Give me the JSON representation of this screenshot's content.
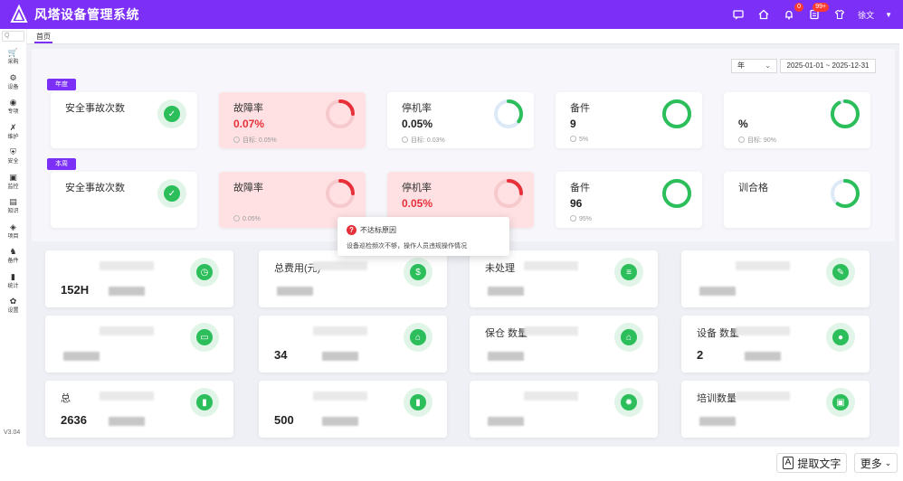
{
  "app": {
    "title": "风塔设备管理系统",
    "user": "徐文",
    "badge_count": "0",
    "badge_count2": "99+"
  },
  "sidebar": {
    "search_placeholder": "Q",
    "items": [
      {
        "label": "采购",
        "glyph": "🛒",
        "icon": "cart-icon"
      },
      {
        "label": "设备",
        "glyph": "⚙",
        "icon": "device-icon"
      },
      {
        "label": "专项",
        "glyph": "◉",
        "icon": "special-icon"
      },
      {
        "label": "维护",
        "glyph": "✗",
        "icon": "tools-icon"
      },
      {
        "label": "安全",
        "glyph": "⛨",
        "icon": "shield-icon"
      },
      {
        "label": "监控",
        "glyph": "▣",
        "icon": "monitor-icon"
      },
      {
        "label": "知识",
        "glyph": "▤",
        "icon": "book-icon"
      },
      {
        "label": "项目",
        "glyph": "◈",
        "icon": "project-icon"
      },
      {
        "label": "备件",
        "glyph": "♞",
        "icon": "parts-icon"
      },
      {
        "label": "统计",
        "glyph": "▮",
        "icon": "chart-icon"
      },
      {
        "label": "设置",
        "glyph": "✿",
        "icon": "settings-icon"
      }
    ],
    "version": "V3.04"
  },
  "tabs": {
    "home": "首页"
  },
  "filters": {
    "period": "年",
    "date_range": "2025-01-01 ~ 2025-12-31"
  },
  "sections": {
    "year": "年度",
    "week": "本周"
  },
  "kpi_year": [
    {
      "label": "安全事故次数",
      "value": "",
      "target": "",
      "icon": "shield-check-icon"
    },
    {
      "label": "故障率",
      "value": "0.07%",
      "target": "目标: 0.05%",
      "alert": true,
      "ring": 0.25,
      "ring_color": "#e8303a"
    },
    {
      "label": "停机率",
      "value": "0.05%",
      "target": "目标: 0.03%",
      "ring": 0.35,
      "ring_color": "#2cbe5b"
    },
    {
      "label": "备件",
      "value": "9",
      "target": "5%",
      "ring": 1.0,
      "ring_color": "#2cbe5b"
    },
    {
      "label": "",
      "value": "%",
      "target": "目标: 90%",
      "ring": 0.92,
      "ring_color": "#2cbe5b"
    }
  ],
  "kpi_week": [
    {
      "label": "安全事故次数",
      "value": "",
      "target": "",
      "icon": "shield-check-icon"
    },
    {
      "label": "故障率",
      "value": "",
      "target": "0.05%",
      "alert": true,
      "ring": 0.25,
      "ring_color": "#e8303a"
    },
    {
      "label": "停机率",
      "value": "0.05%",
      "target": "",
      "alert": true,
      "ring": 0.25,
      "ring_color": "#e8303a"
    },
    {
      "label": "备件",
      "value": "96",
      "target": "95%",
      "ring": 1.0,
      "ring_color": "#2cbe5b"
    },
    {
      "label": "训合格",
      "value": "",
      "target": "",
      "ring": 0.6,
      "ring_color": "#2cbe5b"
    }
  ],
  "tooltip": {
    "title": "不达标原因",
    "body": "设备巡检频次不够，操作人员违规操作情况"
  },
  "stats": [
    {
      "label": "",
      "value": "152H",
      "icon": "clock-icon",
      "glyph": "◷"
    },
    {
      "label": "总费用(元)",
      "value": "",
      "icon": "money-bag-icon",
      "glyph": "$"
    },
    {
      "label": "未处理",
      "value": "",
      "icon": "list-icon",
      "glyph": "≡"
    },
    {
      "label": "",
      "value": "",
      "icon": "file-icon",
      "glyph": "✎"
    },
    {
      "label": "",
      "value": "",
      "icon": "card-icon",
      "glyph": "▭"
    },
    {
      "label": "",
      "value": "34",
      "icon": "store-icon",
      "glyph": "⌂"
    },
    {
      "label": "保仓 数量",
      "value": "",
      "icon": "warehouse-icon",
      "glyph": "⌂"
    },
    {
      "label": "设备 数量",
      "value": "2",
      "icon": "device-icon",
      "glyph": "●"
    },
    {
      "label": "总",
      "value": "2636",
      "icon": "box-icon",
      "glyph": "▮"
    },
    {
      "label": "",
      "value": "500",
      "icon": "box-icon",
      "glyph": "▮"
    },
    {
      "label": "",
      "value": "",
      "icon": "sun-icon",
      "glyph": "✹"
    },
    {
      "label": "培训数量",
      "value": "",
      "icon": "chat-icon",
      "glyph": "▣"
    }
  ],
  "footer": {
    "ocr_label": "提取文字",
    "more_label": "更多"
  }
}
